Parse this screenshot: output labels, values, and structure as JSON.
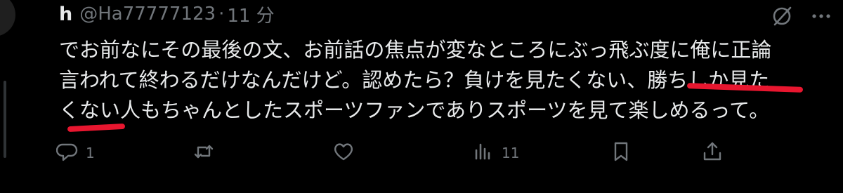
{
  "tweet": {
    "display_name": "h",
    "handle": "@Ha77777123",
    "separator": "·",
    "timestamp": "11 分",
    "text": "でお前なにその最後の文、お前話の焦点が変なところにぶっ飛ぶ度に俺に正論\n言われて終わるだけなんだけど。認めたら？負けを見たくない、勝ちしか見た\nくない人もちゃんとしたスポーツファンでありスポーツを見て楽しめるって。"
  },
  "actions": {
    "reply_count": "1",
    "retweet_count": "",
    "like_count": "",
    "views_count": "11"
  },
  "icons": {
    "top": [
      "grok-icon",
      "more-icon"
    ],
    "bar": [
      "reply-icon",
      "retweet-icon",
      "like-icon",
      "views-icon",
      "bookmark-icon",
      "share-icon"
    ]
  },
  "colors": {
    "background": "#000000",
    "text": "#e7e9ea",
    "secondary": "#71767b",
    "highlight_mark": "#e8162f"
  }
}
